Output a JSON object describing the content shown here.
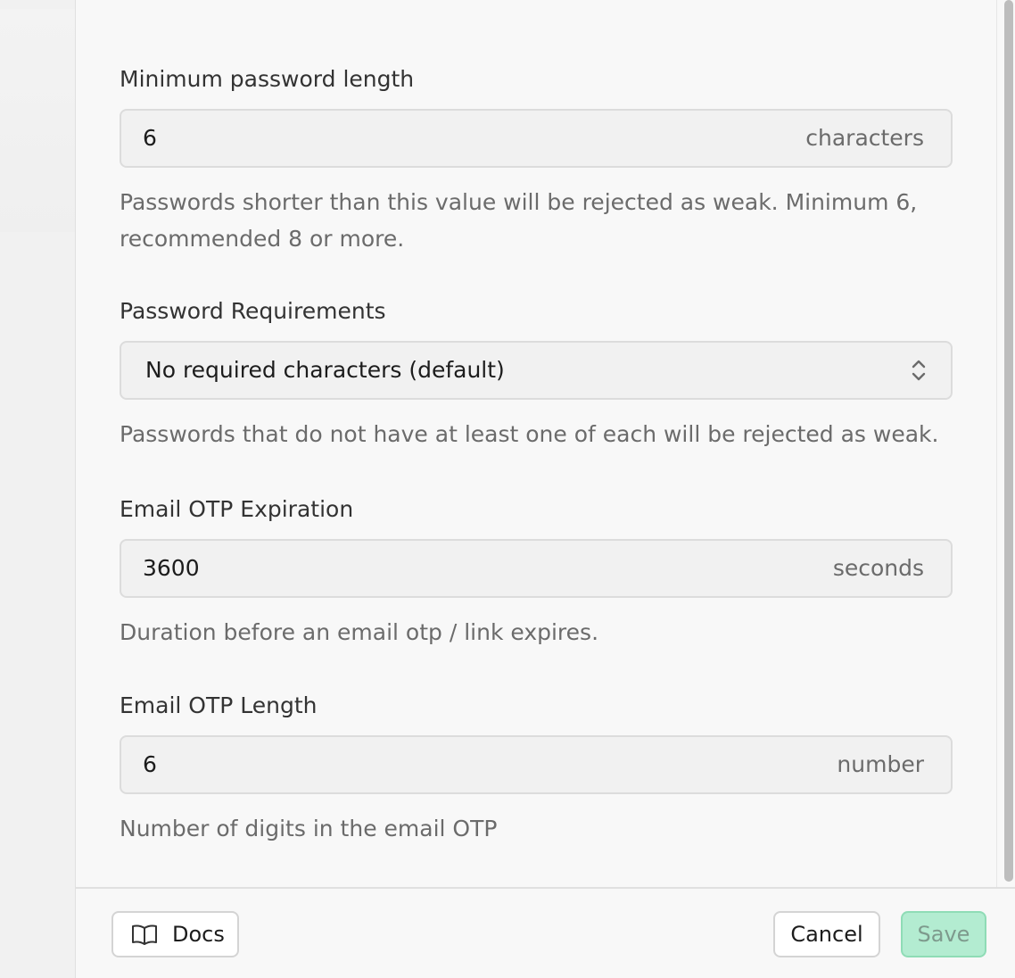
{
  "fields": [
    {
      "label": "Minimum password length",
      "value": "6",
      "suffix": "characters",
      "help": "Passwords shorter than this value will be rejected as weak. Minimum 6, recommended 8 or more."
    },
    {
      "label": "Password Requirements",
      "value": "No required characters (default)",
      "icon": "chevron-up-down-icon",
      "help": "Passwords that do not have at least one of each will be rejected as weak."
    },
    {
      "label": "Email OTP Expiration",
      "value": "3600",
      "suffix": "seconds",
      "help": "Duration before an email otp / link expires."
    },
    {
      "label": "Email OTP Length",
      "value": "6",
      "suffix": "number",
      "help": "Number of digits in the email OTP"
    }
  ],
  "footer": {
    "docs_label": "Docs",
    "docs_icon": "book-open-icon",
    "cancel_label": "Cancel",
    "save_label": "Save"
  },
  "colors": {
    "save_bg": "#b3ecd1",
    "save_border": "#8fdcb6",
    "panel_bg": "#f8f8f8"
  }
}
